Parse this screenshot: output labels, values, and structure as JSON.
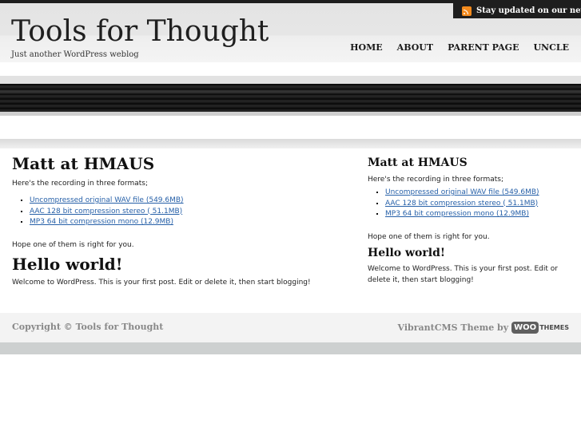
{
  "header": {
    "rss_label": "Stay updated on our news",
    "site_title": "Tools for Thought",
    "tagline": "Just another WordPress weblog",
    "nav": [
      "HOME",
      "ABOUT",
      "PARENT PAGE",
      "UNCLE"
    ]
  },
  "main": {
    "post1": {
      "title": "Matt at HMAUS",
      "intro": "Here's the recording in three formats;",
      "links": [
        "Uncompressed original WAV file (549.6MB)",
        "AAC 128 bit compression stereo ( 51.1MB)",
        "MP3 64 bit compression mono (12.9MB)"
      ],
      "outro": "Hope one of them is right for you."
    },
    "post2": {
      "title": "Hello world!",
      "body": "Welcome to WordPress. This is your first post. Edit or delete it, then start blogging!"
    }
  },
  "sidebar": {
    "post1": {
      "title": "Matt at HMAUS",
      "intro": "Here's the recording in three formats;",
      "links": [
        "Uncompressed original WAV file (549.6MB)",
        "AAC 128 bit compression stereo ( 51.1MB)",
        "MP3 64 bit compression mono (12.9MB)"
      ],
      "outro": "Hope one of them is right for you."
    },
    "post2": {
      "title": "Hello world!",
      "body": "Welcome to WordPress. This is your first post. Edit or delete it, then start blogging!"
    }
  },
  "footer": {
    "copyright": "Copyright © Tools for Thought",
    "credit": "VibrantCMS Theme by",
    "woo_logo_word": "WOO",
    "woo_logo_suffix": "THEMES"
  },
  "colors": {
    "link": "#2660a8",
    "rss_orange": "#f38a1d",
    "top_bar": "#1e1e1e"
  }
}
